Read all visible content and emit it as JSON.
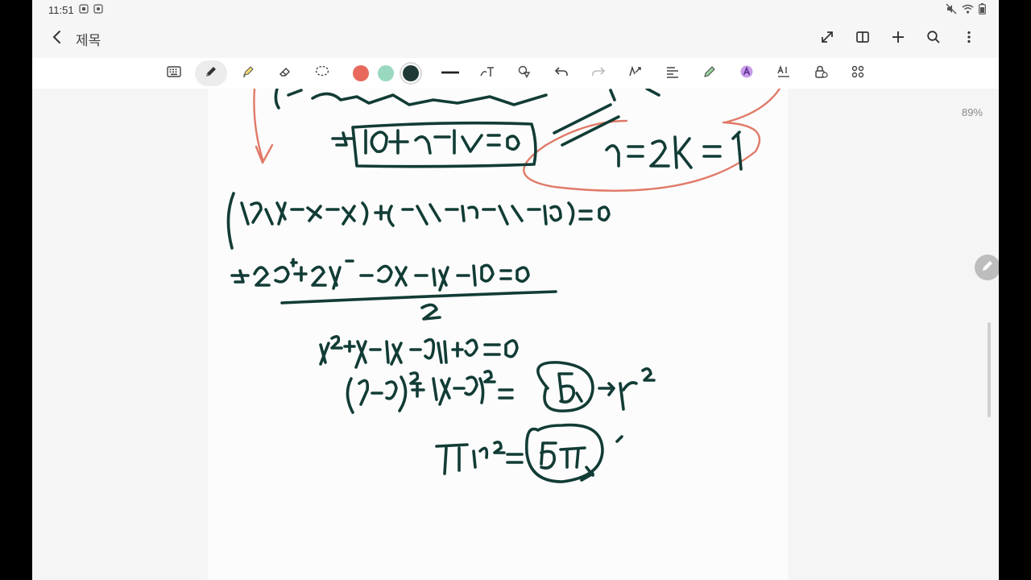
{
  "status_bar": {
    "time": "11:51",
    "left_icons": [
      "screenshot-icon",
      "screen-record-icon"
    ],
    "right_icons": [
      "mute-icon",
      "wifi-icon",
      "battery-icon"
    ]
  },
  "title_bar": {
    "back_icon": "chevron-left-icon",
    "title": "제목",
    "actions": [
      "expand-icon",
      "split-view-icon",
      "add-icon",
      "search-icon",
      "more-vertical-icon"
    ]
  },
  "toolbar": {
    "tools": [
      "keyboard-icon",
      "pen-icon",
      "highlighter-icon",
      "eraser-icon",
      "lasso-icon"
    ],
    "active_tool": "pen-icon",
    "colors": [
      "#e8695c",
      "#9ad8c0",
      "#1f3a36"
    ],
    "selected_color": "#1f3a36",
    "actions": [
      "stroke-width-icon",
      "text-icon",
      "shapes-icon",
      "undo-icon",
      "redo-icon",
      "ink-to-text-icon",
      "align-icon",
      "pencil-alt-icon",
      "text-style-icon",
      "text-size-icon",
      "lock-icon",
      "more-grid-icon"
    ]
  },
  "canvas": {
    "zoom": "89%",
    "floating_button_icon": "pen-icon"
  }
}
